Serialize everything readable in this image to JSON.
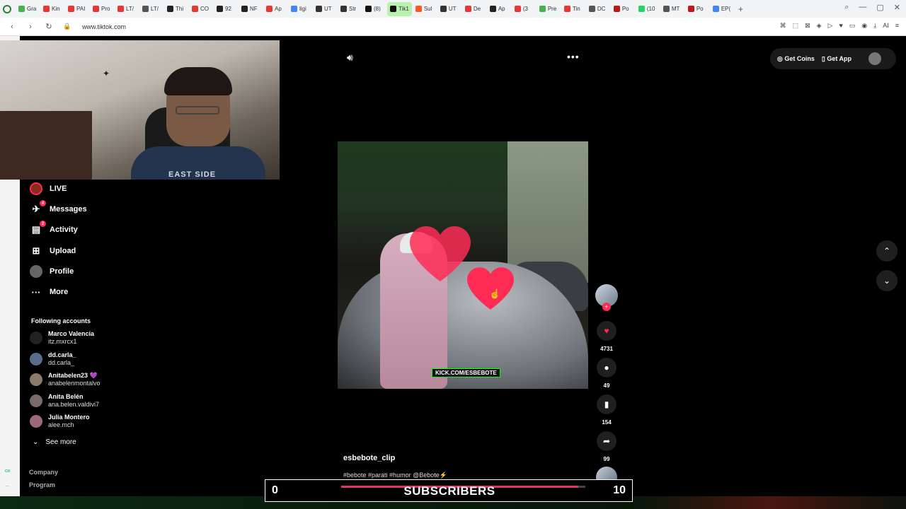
{
  "browser": {
    "tabs": [
      {
        "label": "Gra",
        "color": "#4caf50"
      },
      {
        "label": "Kin",
        "color": "#e53935"
      },
      {
        "label": "PAI",
        "color": "#e53935"
      },
      {
        "label": "Pro",
        "color": "#e53935"
      },
      {
        "label": "LT/",
        "color": "#e53935"
      },
      {
        "label": "LT/",
        "color": "#555555"
      },
      {
        "label": "Thi",
        "color": "#222222"
      },
      {
        "label": "CO",
        "color": "#e53935"
      },
      {
        "label": "92",
        "color": "#222222"
      },
      {
        "label": "NF",
        "color": "#222222"
      },
      {
        "label": "Ap",
        "color": "#e53935"
      },
      {
        "label": "ligi",
        "color": "#4285f4"
      },
      {
        "label": "UT",
        "color": "#333333"
      },
      {
        "label": "Str",
        "color": "#333333"
      },
      {
        "label": "(8)",
        "color": "#111111"
      },
      {
        "label": "Tik1",
        "color": "#111111",
        "active": true
      },
      {
        "label": "Sul",
        "color": "#ff5722"
      },
      {
        "label": "UT",
        "color": "#333333"
      },
      {
        "label": "De",
        "color": "#e53935"
      },
      {
        "label": "Ap",
        "color": "#222222"
      },
      {
        "label": "(3",
        "color": "#e53935"
      },
      {
        "label": "Pre",
        "color": "#4caf50"
      },
      {
        "label": "Tin",
        "color": "#e53935"
      },
      {
        "label": "DC",
        "color": "#555555"
      },
      {
        "label": "Po",
        "color": "#b71c1c"
      },
      {
        "label": "(10",
        "color": "#25d366"
      },
      {
        "label": "MT",
        "color": "#555555"
      },
      {
        "label": "Po",
        "color": "#b71c1c"
      },
      {
        "label": "EP(",
        "color": "#4285f4"
      }
    ],
    "new_tab": "+",
    "url": "www.tiktok.com"
  },
  "sidebar": {
    "items": [
      {
        "label": "LIVE",
        "icon": "live-icon",
        "badge": ""
      },
      {
        "label": "Messages",
        "icon": "messages-icon",
        "badge": "4"
      },
      {
        "label": "Activity",
        "icon": "activity-icon",
        "badge": "2"
      },
      {
        "label": "Upload",
        "icon": "upload-icon",
        "badge": ""
      },
      {
        "label": "Profile",
        "icon": "profile-icon",
        "badge": ""
      },
      {
        "label": "More",
        "icon": "more-icon",
        "badge": ""
      }
    ],
    "following_title": "Following accounts",
    "accounts": [
      {
        "name": "Marco Valencia",
        "handle": "itz.mxrcx1"
      },
      {
        "name": "dd.carla_",
        "handle": "dd.carla_"
      },
      {
        "name": "Anitabelen23 💜",
        "handle": "anabelenmontalvo"
      },
      {
        "name": "Anita Belén",
        "handle": "ana.belen.valdivi7"
      },
      {
        "name": "Julia Montero",
        "handle": "alee.mch"
      }
    ],
    "see_more": "See more",
    "footer": [
      "Company",
      "Program"
    ]
  },
  "webcam": {
    "shirt_text": "EAST SIDE"
  },
  "header": {
    "get_coins": "Get Coins",
    "get_app": "Get App"
  },
  "video": {
    "overlay_tag": "KICK.COM/ESBEBOTE",
    "author": "esbebote_clip",
    "description": "#bebote #parati #humor @Bebote⚡"
  },
  "actions": {
    "likes": "4731",
    "comments": "49",
    "saves": "154",
    "shares": "99"
  },
  "subscribers": {
    "title": "SUBSCRIBERS",
    "current": "0",
    "goal": "10",
    "progress": 0.97,
    "color": "#e8326a"
  },
  "colors": {
    "accent": "#fe2c55",
    "active_tab": "#b9f2b0"
  }
}
